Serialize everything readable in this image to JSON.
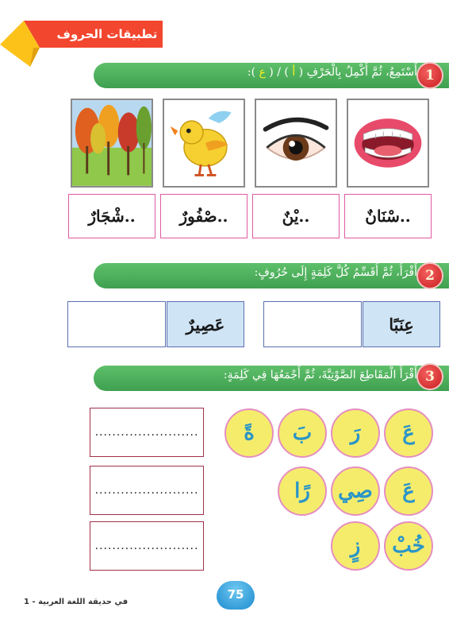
{
  "banner": {
    "title": "تطبيقات الحروف"
  },
  "sections": [
    {
      "number": "1",
      "instruction_start": "أَسْتَمِعُ، ثُمَّ أُكْمِلُ بِالْحَرْفِ ( ",
      "letter_a": "أ",
      "instruction_mid": " ) / ( ",
      "letter_b": "ع",
      "instruction_end": " ):"
    },
    {
      "number": "2",
      "instruction": "أَقْرَأُ، ثُمَّ أُقَسِّمُ كُلَّ كَلِمَةٍ إِلَى حُرُوفٍ:"
    },
    {
      "number": "3",
      "instruction": "أَقْرَأُ الْمَقَاطِعَ الصَّوْتِيَّةَ، ثُمَّ أَجْمَعُهَا فِي كَلِمَةٍ:"
    }
  ],
  "pictures": [
    {
      "icon": "mouth-teeth-icon"
    },
    {
      "icon": "eye-icon"
    },
    {
      "icon": "bird-icon"
    },
    {
      "icon": "trees-icon"
    }
  ],
  "words_row1": [
    "..سْنَانٌ",
    "..يْنٌ",
    "..صْفُورٌ",
    "..شْجَارٌ"
  ],
  "section2_words": [
    "عِنَبًا",
    "عَصِيرٌ"
  ],
  "syllables": {
    "row1": [
      "عَ",
      "رَ",
      "بَ",
      "ةً"
    ],
    "row2": [
      "عَ",
      "صِي",
      "رًا"
    ],
    "row3": [
      "خُبْ",
      "زٍ"
    ]
  },
  "answer_dots": "........................",
  "footer": {
    "page_number": "75",
    "book_title": "في حديقة اللغة العربية - 1"
  },
  "colors": {
    "green": "#4cb05a",
    "red_badge": "#d42a2a",
    "yellow_circle": "#f5ec6c",
    "blue_text": "#2a95c8",
    "banner": "#f2462e"
  }
}
